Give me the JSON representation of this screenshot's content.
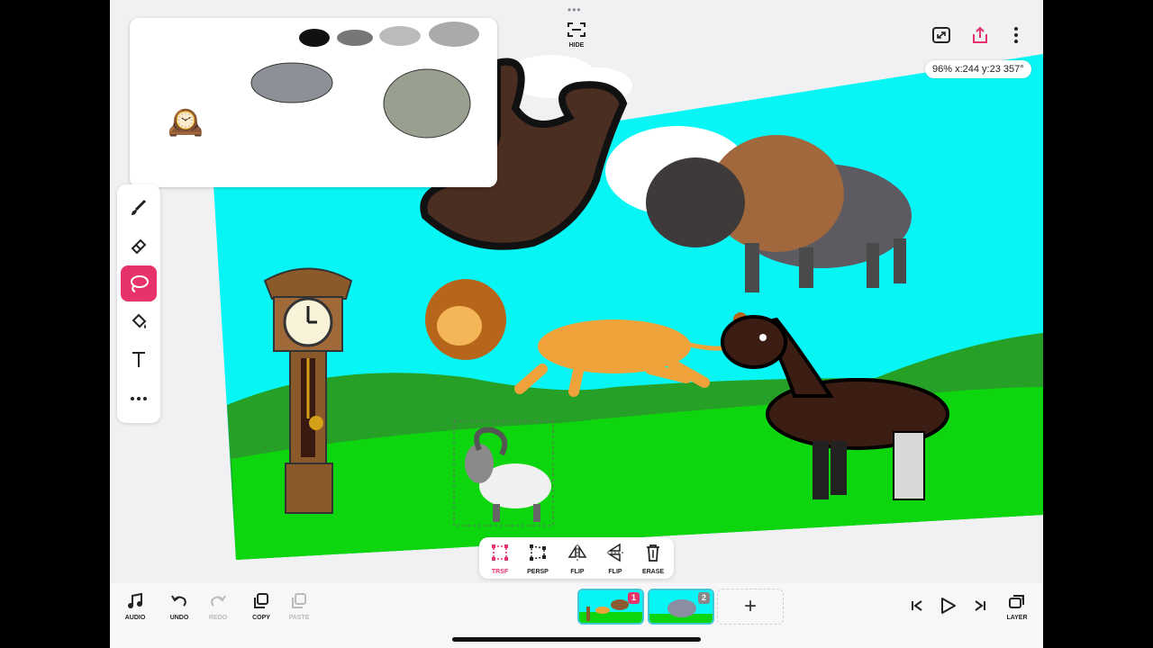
{
  "top": {
    "dots": "•••",
    "hide_label": "HIDE"
  },
  "status": {
    "text": "96% x:244 y:23 357°"
  },
  "preview_icons": {
    "clock": "🕰️"
  },
  "tools": [
    "brush-icon",
    "eraser-icon",
    "lasso-icon",
    "fill-icon",
    "text-icon",
    "more-icon"
  ],
  "transform_bar": {
    "trsf_label": "TRSF",
    "persp_label": "PERSP",
    "flip_h_label": "FLIP",
    "flip_v_label": "FLIP",
    "erase_label": "ERASE"
  },
  "bottom": {
    "audio_label": "AUDIO",
    "undo_label": "UNDO",
    "redo_label": "REDO",
    "copy_label": "COPY",
    "paste_label": "PASTE",
    "frame1_number": "1",
    "frame2_number": "2",
    "add_frame": "+",
    "layer_label": "LAYER"
  },
  "colors": {
    "accent": "#e8336a",
    "sky": "#08f5f5",
    "grass": "#0ed60e",
    "hill": "#26a026"
  }
}
